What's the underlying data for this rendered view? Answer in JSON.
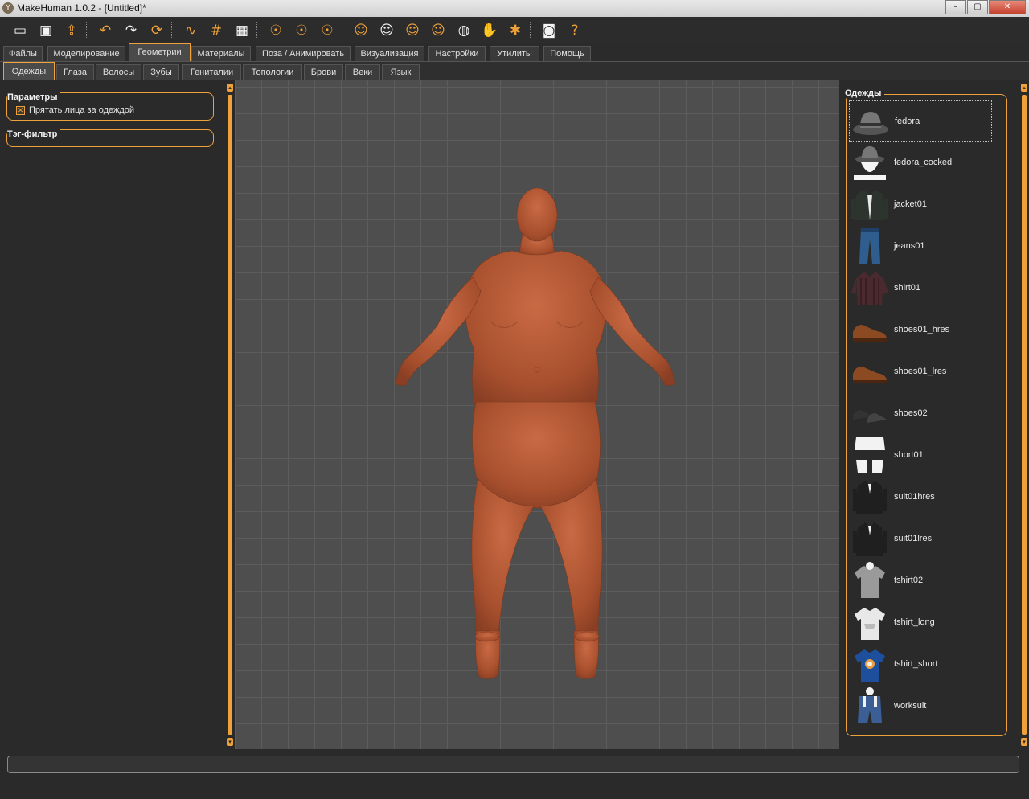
{
  "window": {
    "title": "MakeHuman 1.0.2 - [Untitled]*",
    "controls": [
      "–",
      "▢",
      "✕"
    ]
  },
  "toolbar": {
    "icons": [
      {
        "name": "open-file-icon",
        "glyph": "▭",
        "tint": "white"
      },
      {
        "name": "save-icon",
        "glyph": "▣",
        "tint": "white"
      },
      {
        "name": "export-icon",
        "glyph": "⇪",
        "tint": "orange"
      },
      {
        "name": "undo-icon",
        "glyph": "↶",
        "tint": "orange"
      },
      {
        "name": "redo-icon",
        "glyph": "↷",
        "tint": "white"
      },
      {
        "name": "reset-icon",
        "glyph": "⟳",
        "tint": "orange"
      },
      {
        "name": "smooth-icon",
        "glyph": "∿",
        "tint": "orange"
      },
      {
        "name": "wireframe-icon",
        "glyph": "#",
        "tint": "orange"
      },
      {
        "name": "background-icon",
        "glyph": "▦",
        "tint": "white"
      },
      {
        "name": "front-view-icon",
        "glyph": "☉",
        "tint": "orange"
      },
      {
        "name": "back-view-icon",
        "glyph": "☉",
        "tint": "orange"
      },
      {
        "name": "side-view-icon",
        "glyph": "☉",
        "tint": "orange"
      },
      {
        "name": "head-front-icon",
        "glyph": "☺",
        "tint": "orange"
      },
      {
        "name": "head-back-icon",
        "glyph": "☺",
        "tint": "white"
      },
      {
        "name": "head-left-icon",
        "glyph": "☺",
        "tint": "orange"
      },
      {
        "name": "head-right-icon",
        "glyph": "☺",
        "tint": "orange"
      },
      {
        "name": "face-mask-icon",
        "glyph": "◍",
        "tint": "white"
      },
      {
        "name": "hands-icon",
        "glyph": "✋",
        "tint": "orange"
      },
      {
        "name": "pose-figure-icon",
        "glyph": "✱",
        "tint": "orange"
      },
      {
        "name": "camera-icon",
        "glyph": "◙",
        "tint": "white"
      },
      {
        "name": "help-icon",
        "glyph": "?",
        "tint": "orange"
      }
    ]
  },
  "main_tabs": [
    {
      "label": "Файлы",
      "active": false
    },
    {
      "label": "Моделирование",
      "active": false
    },
    {
      "label": "Геометрии",
      "active": true
    },
    {
      "label": "Материалы",
      "active": false
    },
    {
      "label": "Поза / Анимировать",
      "active": false
    },
    {
      "label": "Визуализация",
      "active": false
    },
    {
      "label": "Настройки",
      "active": false
    },
    {
      "label": "Утилиты",
      "active": false
    },
    {
      "label": "Помощь",
      "active": false
    }
  ],
  "sub_tabs": [
    {
      "label": "Одежды",
      "active": true
    },
    {
      "label": "Глаза",
      "active": false
    },
    {
      "label": "Волосы",
      "active": false
    },
    {
      "label": "Зубы",
      "active": false
    },
    {
      "label": "Гениталии",
      "active": false
    },
    {
      "label": "Топологии",
      "active": false
    },
    {
      "label": "Брови",
      "active": false
    },
    {
      "label": "Веки",
      "active": false
    },
    {
      "label": "Язык",
      "active": false
    }
  ],
  "left_panel": {
    "params_title": "Параметры",
    "hide_faces_label": "Прятать лица за одеждой",
    "hide_faces_checked": true,
    "tag_filter_title": "Тэг-фильтр"
  },
  "right_panel": {
    "title": "Одежды",
    "items": [
      {
        "label": "fedora",
        "thumb": "hat",
        "selected": true
      },
      {
        "label": "fedora_cocked",
        "thumb": "hat-head",
        "selected": false
      },
      {
        "label": "jacket01",
        "thumb": "jacket",
        "selected": false
      },
      {
        "label": "jeans01",
        "thumb": "jeans",
        "selected": false
      },
      {
        "label": "shirt01",
        "thumb": "shirt",
        "selected": false
      },
      {
        "label": "shoes01_hres",
        "thumb": "shoe",
        "selected": false
      },
      {
        "label": "shoes01_lres",
        "thumb": "shoe",
        "selected": false
      },
      {
        "label": "shoes02",
        "thumb": "shoe-dark",
        "selected": false
      },
      {
        "label": "short01",
        "thumb": "shorts",
        "selected": false
      },
      {
        "label": "suit01hres",
        "thumb": "suit",
        "selected": false
      },
      {
        "label": "suit01lres",
        "thumb": "suit",
        "selected": false
      },
      {
        "label": "tshirt02",
        "thumb": "tshirt-gray",
        "selected": false
      },
      {
        "label": "tshirt_long",
        "thumb": "tshirt-white",
        "selected": false
      },
      {
        "label": "tshirt_short",
        "thumb": "tshirt-blue",
        "selected": false
      },
      {
        "label": "worksuit",
        "thumb": "worksuit",
        "selected": false
      }
    ]
  },
  "colors": {
    "accent": "#f0a23a",
    "skin": "#b5542f",
    "panel": "#2a2a2a",
    "viewport": "#4e4e4e"
  },
  "status": {
    "text": ""
  }
}
